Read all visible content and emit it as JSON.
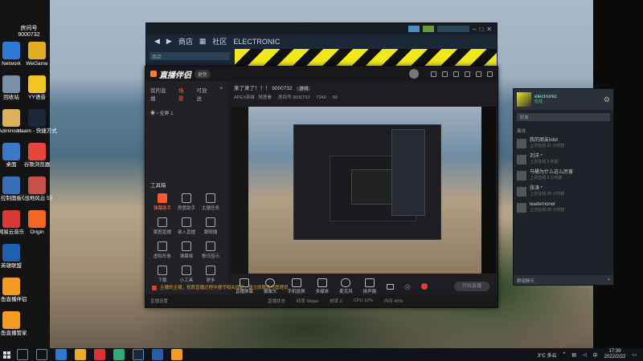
{
  "desktop": {
    "icons": [
      {
        "label": "Network",
        "color": "#2d7ad6"
      },
      {
        "label": "WeGame",
        "color": "#e0b020"
      },
      {
        "label": "回收站",
        "color": "#7a8fa8"
      },
      {
        "label": "YY语音",
        "color": "#f3c322"
      },
      {
        "label": "Administr...",
        "color": "#d9b25a"
      },
      {
        "label": "steam - 快捷方式",
        "color": "#1b2838"
      },
      {
        "label": "桌面",
        "color": "#3a78c8"
      },
      {
        "label": "谷歌浏览器",
        "color": "#e8453c"
      },
      {
        "label": "控制面板",
        "color": "#3a6fb8"
      },
      {
        "label": "《战地风云 5》",
        "color": "#c8504a"
      },
      {
        "label": "网易云音乐",
        "color": "#d43c33"
      },
      {
        "label": "Origin",
        "color": "#f26722"
      },
      {
        "label": "英雄联盟",
        "color": "#1f5fb0"
      },
      {
        "label": "斗鱼直播伴侣",
        "color": "#f59a23"
      },
      {
        "label": "斗鱼直播管家",
        "color": "#f59a23"
      }
    ],
    "top_label": "房间号",
    "top_value": "9000732"
  },
  "steam": {
    "nav": [
      "商店",
      "社区",
      "ELECTRONIC"
    ],
    "url": "商店"
  },
  "douyu": {
    "logo": "直播伴侣",
    "version": "更新",
    "tabs": [
      "我的直播",
      "场景",
      "可放送"
    ],
    "scene": "全屏 1",
    "room_title": "来了来了！！！ 9000732",
    "room_tag": "游戏",
    "room_meta": [
      "APEX英雄 · 随意看",
      "房间号 9000732",
      "7240",
      "58"
    ],
    "tools_title": "工具箱",
    "tools": [
      "弹幕助手",
      "房管助手",
      "主播任务",
      "截图直播",
      "录入直播",
      "跟随播",
      "虚拟形象",
      "弹幕姬",
      "歌词显示",
      "下载",
      "小工具",
      "更多"
    ],
    "controls": [
      "直播屏幕",
      "摄像头",
      "手机投屏",
      "多媒体",
      "麦克风",
      "扬声器"
    ],
    "start_label": "开始直播",
    "notice": "主播的主播，祝愿直播过程中遵守相关规定，请立即联系与管理员",
    "status": [
      "直播状态",
      "码率 0kbps",
      "帧率 0",
      "CPU 12%",
      "内存 45%"
    ],
    "status_left": "直播设置"
  },
  "friends": {
    "name": "electronic",
    "status": "在线",
    "search_placeholder": "好友",
    "group": "离线",
    "items": [
      {
        "name": "我的朋友lolol",
        "last": "上次在线 21 小时前"
      },
      {
        "name": "刘洋 *",
        "last": "上次在线 2 天前"
      },
      {
        "name": "马桶为什么这么厉害",
        "last": "上次在线 3 小时前"
      },
      {
        "name": "张涛 *",
        "last": "上次在线 23 小时前"
      },
      {
        "name": "leadernoner",
        "last": "上次在线 25 小时前"
      }
    ],
    "bottom": "群组聊天"
  },
  "taskbar": {
    "temp": "3°C 多云",
    "time": "17:39",
    "date": "2022/2/22",
    "lang": "中"
  }
}
